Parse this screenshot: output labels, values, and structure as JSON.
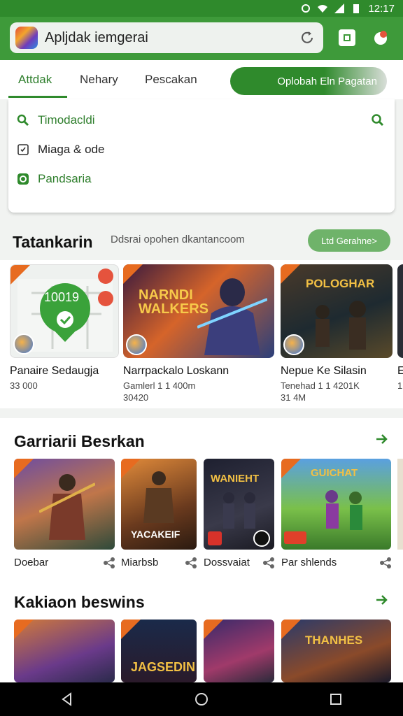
{
  "status": {
    "time": "12:17"
  },
  "search": {
    "text": "Apljdak iemgerai"
  },
  "tabs": [
    {
      "label": "Attdak"
    },
    {
      "label": "Nehary"
    },
    {
      "label": "Pescakan"
    }
  ],
  "pill_label": "Oplobah Eln Pagatan",
  "dropdown": {
    "items": [
      {
        "label": "Timodacldi",
        "icon": "search-icon"
      },
      {
        "label": "Miaga & ode",
        "icon": "checkbox-icon"
      },
      {
        "label": "Pandsaria",
        "icon": "toggle-icon"
      }
    ]
  },
  "section1": {
    "title": "Tatankarin",
    "subtitle": "Ddsrai opohen dkantancoom",
    "button": "Ltd Gerahne>",
    "cards": [
      {
        "name": "Panaire Sedaugja",
        "meta": "33 000",
        "meta2": "",
        "thumb_text": "10019"
      },
      {
        "name": "Narrpackalo Loskann",
        "meta": "Gamlerl 1 1 400m",
        "meta2": "30420",
        "thumb_text": "NARNDI WALKERS"
      },
      {
        "name": "Nepue Ke Silasin",
        "meta": "Tenehad 1 1 4201K",
        "meta2": "31 4M",
        "thumb_text": "POLOGHAR"
      },
      {
        "name": "E",
        "meta": "1",
        "meta2": "",
        "thumb_text": ""
      }
    ]
  },
  "section2": {
    "title": "Garriarii Besrkan",
    "items": [
      {
        "label": "Doebar"
      },
      {
        "label": "Miarbsb"
      },
      {
        "label": "Dossvaiat"
      },
      {
        "label": "Par shlends"
      }
    ],
    "thumb_texts": [
      "",
      "YACAKEIF",
      "WANIEHT",
      "GUICHAT"
    ]
  },
  "section3": {
    "title": "Kakiaon beswins",
    "thumb_texts": [
      "",
      "JAGSEDIN",
      "",
      "THANHES"
    ]
  }
}
